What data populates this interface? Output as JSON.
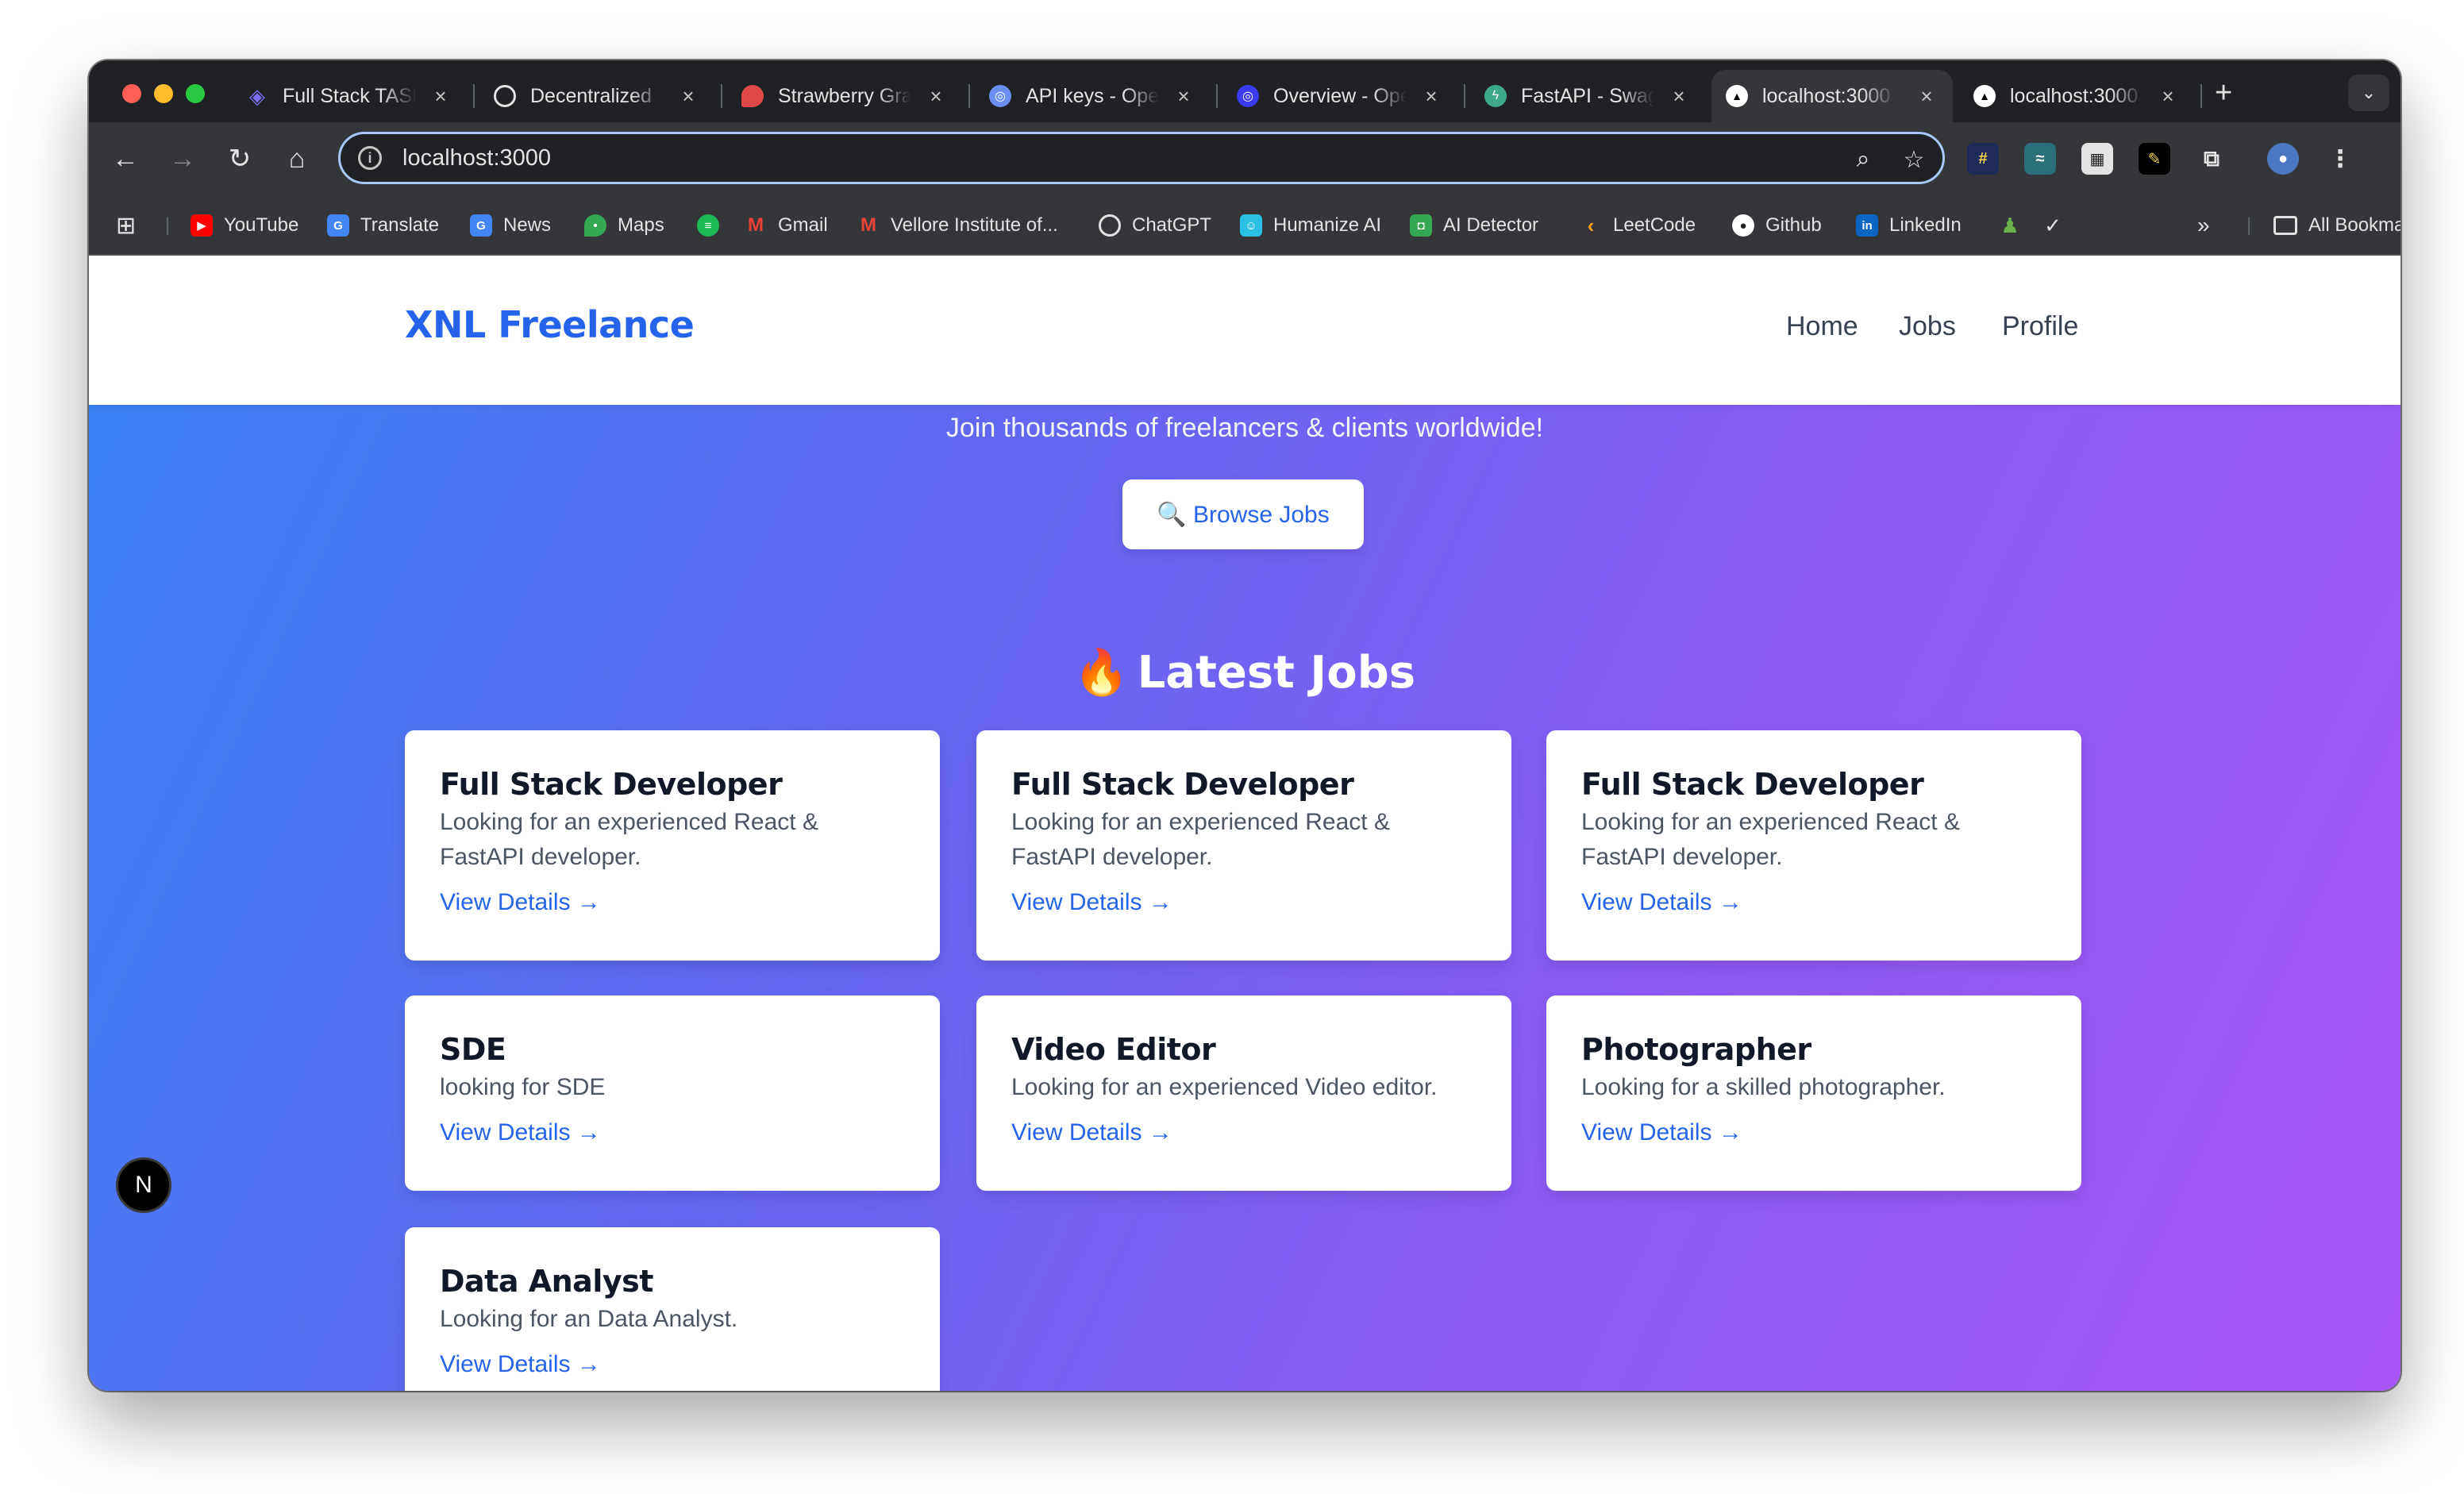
{
  "browser": {
    "tabs": [
      {
        "title": "Full Stack TASK",
        "icon": "layers-icon",
        "color": "#7c6cf0"
      },
      {
        "title": "Decentralized",
        "icon": "openai-icon",
        "color": "#e3e3e3"
      },
      {
        "title": "Strawberry Grape",
        "icon": "strawberry-icon",
        "color": "#e04848"
      },
      {
        "title": "API keys - OpenAI",
        "icon": "globe-icon",
        "color": "#6a8ff0"
      },
      {
        "title": "Overview - OpenAI",
        "icon": "globe-icon",
        "color": "#3b3bf0"
      },
      {
        "title": "FastAPI - Swagger",
        "icon": "fastapi-icon",
        "color": "#3ea88a"
      },
      {
        "title": "localhost:3000",
        "icon": "nextjs-icon",
        "color": "#ffffff"
      },
      {
        "title": "localhost:3000",
        "icon": "nextjs-icon",
        "color": "#ffffff"
      }
    ],
    "active_tab_index": 6,
    "url": "localhost:3000",
    "bookmarks": [
      {
        "label": "YouTube",
        "icon": "youtube-icon",
        "color": "#ff0000"
      },
      {
        "label": "Translate",
        "icon": "translate-icon",
        "color": "#4285f4"
      },
      {
        "label": "News",
        "icon": "news-icon",
        "color": "#4285f4"
      },
      {
        "label": "Maps",
        "icon": "maps-icon",
        "color": "#34a853"
      },
      {
        "label": "",
        "icon": "spotify-icon",
        "color": "#1db954"
      },
      {
        "label": "Gmail",
        "icon": "gmail-icon",
        "color": "#ea4335"
      },
      {
        "label": "Vellore Institute of...",
        "icon": "gmail-icon",
        "color": "#ea4335"
      },
      {
        "label": "ChatGPT",
        "icon": "openai-icon",
        "color": "#e3e3e3"
      },
      {
        "label": "Humanize AI",
        "icon": "humanize-icon",
        "color": "#2bc0e4"
      },
      {
        "label": "AI Detector",
        "icon": "robot-icon",
        "color": "#34a853"
      },
      {
        "label": "LeetCode",
        "icon": "leetcode-icon",
        "color": "#ffa116"
      },
      {
        "label": "Github",
        "icon": "github-icon",
        "color": "#ffffff"
      },
      {
        "label": "LinkedIn",
        "icon": "linkedin-icon",
        "color": "#0a66c2"
      }
    ],
    "all_bookmarks_label": "All Bookmarks"
  },
  "site": {
    "brand": "XNL Freelance",
    "nav": [
      "Home",
      "Jobs",
      "Profile"
    ],
    "tagline": "Join thousands of freelancers & clients worldwide!",
    "browse_button": "🔍 Browse Jobs",
    "section_title": "Latest Jobs",
    "view_details": "View Details →",
    "jobs": [
      {
        "title": "Full Stack Developer",
        "description": "Looking for an experienced React & FastAPI developer."
      },
      {
        "title": "Full Stack Developer",
        "description": "Looking for an experienced React & FastAPI developer."
      },
      {
        "title": "Full Stack Developer",
        "description": "Looking for an experienced React & FastAPI developer."
      },
      {
        "title": "SDE",
        "description": "looking for SDE"
      },
      {
        "title": "Video Editor",
        "description": "Looking for an experienced Video editor."
      },
      {
        "title": "Photographer",
        "description": "Looking for a skilled photographer."
      },
      {
        "title": "Data Analyst",
        "description": "Looking for an Data Analyst."
      }
    ],
    "dev_badge": "N"
  },
  "colors": {
    "brand": "#2563eb",
    "hero_gradient": [
      "#3b82f6",
      "#a855f7"
    ],
    "link": "#2563eb"
  }
}
